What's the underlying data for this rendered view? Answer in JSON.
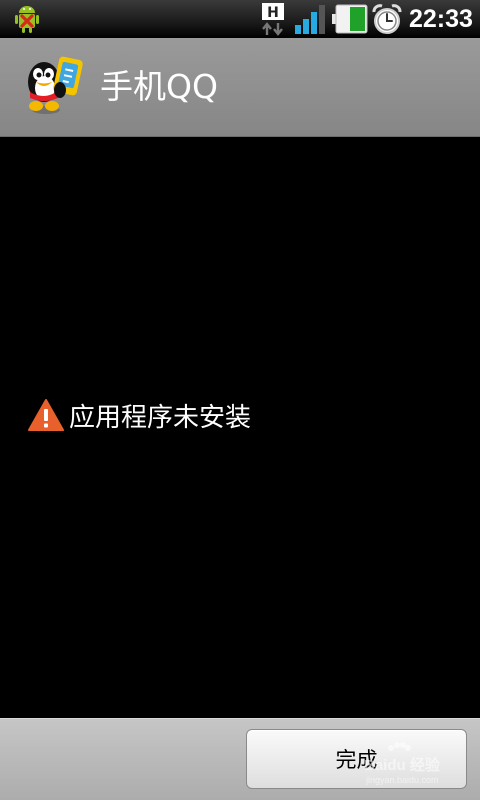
{
  "status_bar": {
    "network_type": "H",
    "time": "22:33",
    "icons": [
      "android-debug-icon",
      "network-h-icon",
      "signal-icon",
      "battery-icon",
      "alarm-clock-icon"
    ]
  },
  "title_bar": {
    "app_name": "手机QQ",
    "icon": "qq-penguin-icon"
  },
  "message": {
    "icon": "warning-icon",
    "text": "应用程序未安装",
    "icon_color": "#e8612c"
  },
  "bottom_bar": {
    "done_label": "完成"
  },
  "watermark": {
    "line1": "Baidu 经验",
    "line2": "jingyan.baidu.com"
  }
}
